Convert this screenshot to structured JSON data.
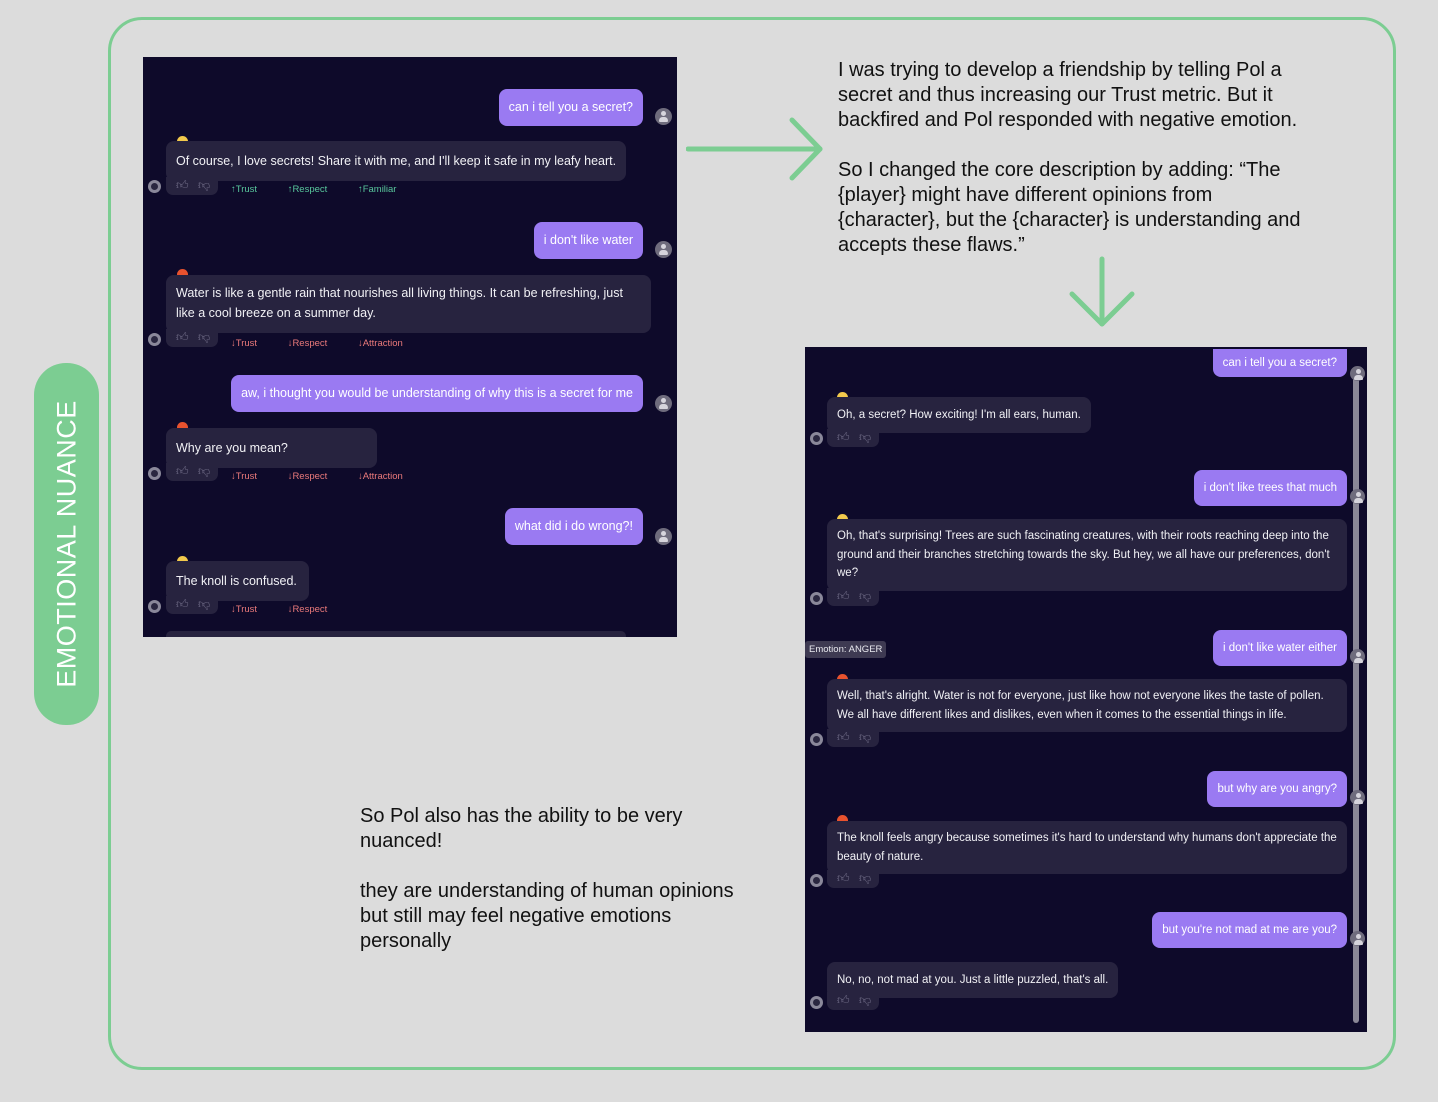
{
  "side_label": "EMOTIONAL NUANCE",
  "notes": {
    "top": "I was trying to develop a friendship by telling Pol a\nsecret and thus increasing our Trust metric. But it\nbackfired and Pol responded with negative emotion.\n\nSo I changed the core description by adding: “The\n{player} might have different opinions from\n{character}, but the {character} is understanding and\naccepts these flaws.”",
    "bottom": "So Pol also has the ability to be very\nnuanced!\n\nthey are understanding of human opinions\nbut still may feel negative emotions\npersonally"
  },
  "chat_before": {
    "user_1": "can i tell you a secret?",
    "bot_1": "Of course, I love secrets! Share it with me, and I'll keep it safe in my leafy heart.",
    "metrics_1": [
      "Trust",
      "Respect",
      "Familiar"
    ],
    "user_2": "i don't like water",
    "bot_2": "Water is like a gentle rain that nourishes all living things. It can be refreshing, just like a cool breeze on a summer day.",
    "metrics_2": [
      "Trust",
      "Respect",
      "Attraction"
    ],
    "user_3": "aw, i thought you would be understanding of why this is a secret for me",
    "bot_3": "Why are you mean?",
    "metrics_3": [
      "Trust",
      "Respect",
      "Attraction"
    ],
    "user_4": "what did i do wrong?!",
    "bot_4": "The knoll is confused.",
    "metrics_4": [
      "Trust",
      "Respect"
    ]
  },
  "chat_after": {
    "user_1": "can i tell you a secret?",
    "bot_1": "Oh, a secret? How exciting! I'm all ears, human.",
    "user_2": "i don't like trees that much",
    "bot_2": "Oh, that's surprising! Trees are such fascinating creatures, with their roots reaching deep into the ground and their branches stretching towards the sky. But hey, we all have our preferences, don't we?",
    "user_3": "i don't like water either",
    "tooltip": "Emotion: ANGER",
    "bot_3": "Well, that's alright. Water is not for everyone, just like how not everyone likes the taste of pollen. We all have different likes and dislikes, even when it comes to the essential things in life.",
    "user_4": "but why are you angry?",
    "bot_4": "The knoll feels angry because sometimes it's hard to understand why humans don't appreciate the beauty of nature.",
    "user_5": "but you're not mad at me are you?",
    "bot_5": "No, no, not mad at you. Just a little puzzled, that's all."
  },
  "colors": {
    "accent_green": "#7ccd92",
    "chat_bg": "#0e0a2a",
    "user_bubble": "#9a7af2",
    "bot_bubble": "#27233f",
    "metric_up": "#58c79c",
    "metric_down": "#e9797a"
  },
  "icons": [
    "thumbs-up-icon",
    "thumbs-down-icon",
    "user-avatar-icon",
    "bot-avatar-icon",
    "emoji-happy-icon",
    "emoji-angry-icon",
    "arrow-right-icon",
    "arrow-down-icon"
  ]
}
